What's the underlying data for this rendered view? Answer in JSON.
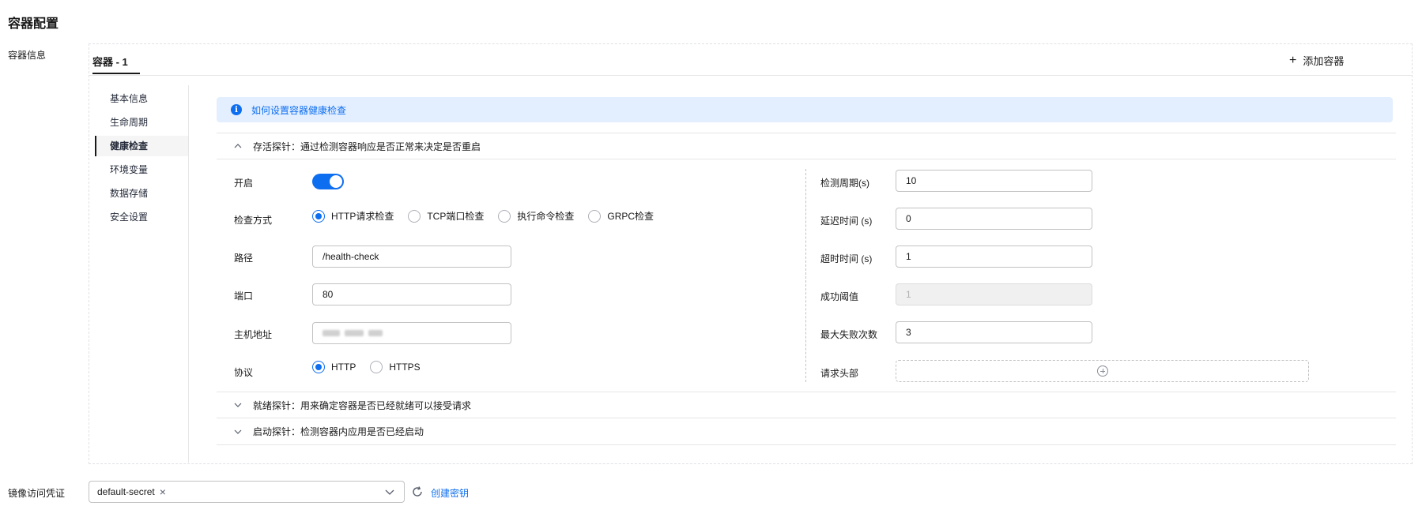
{
  "page_title": "容器配置",
  "section_container_label": "容器信息",
  "tabs": [
    {
      "label": "容器 - 1"
    }
  ],
  "add_container_label": "添加容器",
  "side_menu": [
    {
      "label": "基本信息",
      "active": false
    },
    {
      "label": "生命周期",
      "active": false
    },
    {
      "label": "健康检查",
      "active": true
    },
    {
      "label": "环境变量",
      "active": false
    },
    {
      "label": "数据存储",
      "active": false
    },
    {
      "label": "安全设置",
      "active": false
    }
  ],
  "info_banner": {
    "icon": "info-icon",
    "link_text": "如何设置容器健康检查"
  },
  "liveness_probe": {
    "title": "存活探针：通过检测容器响应是否正常来决定是否重启",
    "expanded": true
  },
  "readiness_probe": {
    "title": "就绪探针：用来确定容器是否已经就绪可以接受请求",
    "expanded": false
  },
  "startup_probe": {
    "title": "启动探针：检测容器内应用是否已经启动",
    "expanded": false
  },
  "form": {
    "enable_label": "开启",
    "enable_on": true,
    "check_method_label": "检查方式",
    "check_methods": [
      {
        "label": "HTTP请求检查",
        "checked": true
      },
      {
        "label": "TCP端口检查",
        "checked": false
      },
      {
        "label": "执行命令检查",
        "checked": false
      },
      {
        "label": "GRPC检查",
        "checked": false
      }
    ],
    "path_label": "路径",
    "path_value": "/health-check",
    "port_label": "端口",
    "port_value": "80",
    "host_label": "主机地址",
    "protocol_label": "协议",
    "protocols": [
      {
        "label": "HTTP",
        "checked": true
      },
      {
        "label": "HTTPS",
        "checked": false
      }
    ],
    "period_label": "检测周期(s)",
    "period_value": "10",
    "delay_label": "延迟时间 (s)",
    "delay_value": "0",
    "timeout_label": "超时时间 (s)",
    "timeout_value": "1",
    "success_label": "成功阈值",
    "success_value": "1",
    "failure_label": "最大失败次数",
    "failure_value": "3",
    "headers_label": "请求头部"
  },
  "image_secret": {
    "label": "镜像访问凭证",
    "selected_tag": "default-secret",
    "create_link": "创建密钥"
  },
  "colors": {
    "accent": "#0d6ef0",
    "banner_bg": "#e3efff",
    "text": "#191919"
  }
}
